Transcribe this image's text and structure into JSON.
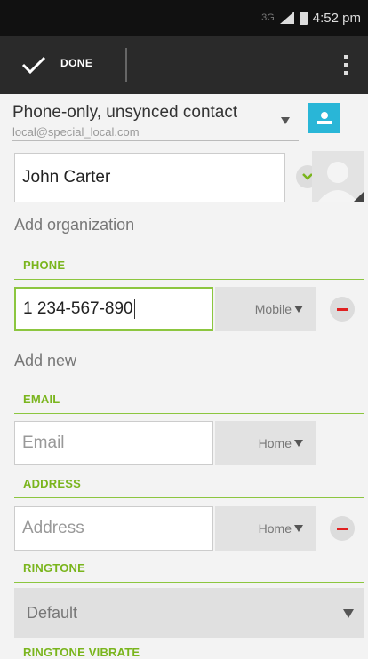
{
  "status_bar": {
    "network": "3G",
    "time": "4:52 pm"
  },
  "action_bar": {
    "done_label": "DONE",
    "done_icon": "check-icon",
    "overflow_icon": "overflow-menu-icon"
  },
  "account": {
    "title": "Phone-only, unsynced contact",
    "email": "local@special_local.com",
    "icon": "contact-card-icon",
    "icon_color": "#29b6d7"
  },
  "name": {
    "value": "John Carter"
  },
  "add_organization": "Add organization",
  "phone": {
    "heading": "PHONE",
    "value": "1 234-567-890",
    "type": "Mobile"
  },
  "add_new": "Add new",
  "email": {
    "heading": "EMAIL",
    "placeholder": "Email",
    "type": "Home"
  },
  "address": {
    "heading": "ADDRESS",
    "placeholder": "Address",
    "type": "Home"
  },
  "ringtone": {
    "heading": "RINGTONE",
    "value": "Default"
  },
  "ringtone_vibrate": {
    "heading": "RINGTONE VIBRATE"
  },
  "accent_color": "#8cc63f"
}
